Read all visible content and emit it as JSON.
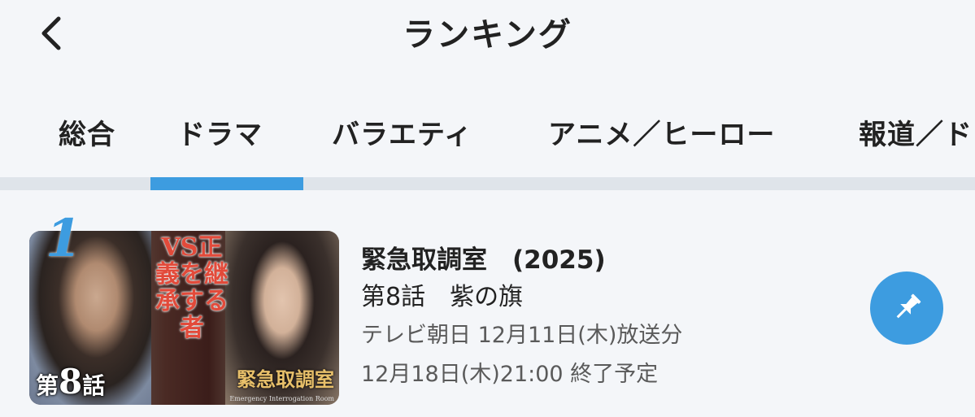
{
  "header": {
    "title": "ランキング",
    "back_icon": "chevron-left-icon"
  },
  "tabs": [
    {
      "label": "総合"
    },
    {
      "label": "ドラマ",
      "active": true
    },
    {
      "label": "バラエティ"
    },
    {
      "label": "アニメ／ヒーロー"
    },
    {
      "label": "報道／ド"
    }
  ],
  "accent_color": "#3d9ce0",
  "ranking": [
    {
      "rank": "1",
      "title": "緊急取調室　(2025)",
      "episode": "第8話　紫の旗",
      "broadcast": "テレビ朝日 12月11日(木)放送分",
      "end": "12月18日(木)21:00 終了予定",
      "thumbnail": {
        "headline": "VS正義を継承する者",
        "episode_badge_prefix": "第",
        "episode_badge_number": "8",
        "episode_badge_suffix": "話",
        "logo": "緊急取調室",
        "logo_sub": "Emergency Interrogation Room"
      },
      "pin_icon": "pushpin-icon"
    }
  ]
}
